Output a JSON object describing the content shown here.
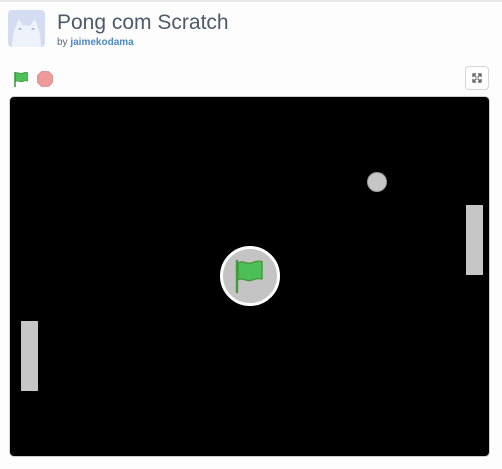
{
  "project": {
    "title": "Pong com Scratch",
    "by_prefix": "by",
    "author": "jaimekodama"
  },
  "controls": {
    "green_flag_icon": "green-flag-icon",
    "stop_icon": "stop-sign-icon",
    "fullscreen_icon": "fullscreen-icon"
  },
  "stage": {
    "background": "#000000",
    "sprites": [
      "left-paddle",
      "right-paddle",
      "ball"
    ],
    "overlay": "green-flag-start-overlay"
  },
  "colors": {
    "title": "#4d5a6b",
    "author_link": "#4a88c7",
    "green_flag": "#4cbf56",
    "stop": "#ec9a9a",
    "sprite_gray": "#c6c6c6"
  }
}
